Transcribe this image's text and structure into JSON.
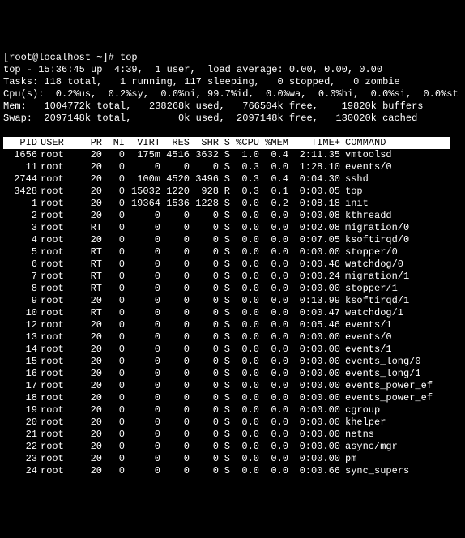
{
  "prompt": {
    "user_host": "[root@localhost ~]# ",
    "command": "top"
  },
  "summary": {
    "line1": "top - 15:36:45 up  4:39,  1 user,  load average: 0.00, 0.00, 0.00",
    "line2": "Tasks: 118 total,   1 running, 117 sleeping,   0 stopped,   0 zombie",
    "line3": "Cpu(s):  0.2%us,  0.2%sy,  0.0%ni, 99.7%id,  0.0%wa,  0.0%hi,  0.0%si,  0.0%st",
    "line4": "Mem:   1004772k total,   238268k used,   766504k free,    19820k buffers",
    "line5": "Swap:  2097148k total,        0k used,  2097148k free,   130020k cached"
  },
  "columns": [
    "PID",
    "USER",
    "PR",
    "NI",
    "VIRT",
    "RES",
    "SHR",
    "S",
    "%CPU",
    "%MEM",
    "TIME+",
    "COMMAND"
  ],
  "rows": [
    {
      "pid": "1656",
      "user": "root",
      "pr": "20",
      "ni": "0",
      "virt": "175m",
      "res": "4516",
      "shr": "3632",
      "s": "S",
      "cpu": "1.0",
      "mem": "0.4",
      "time": "2:11.35",
      "cmd": "vmtoolsd"
    },
    {
      "pid": "11",
      "user": "root",
      "pr": "20",
      "ni": "0",
      "virt": "0",
      "res": "0",
      "shr": "0",
      "s": "S",
      "cpu": "0.3",
      "mem": "0.0",
      "time": "1:28.10",
      "cmd": "events/0"
    },
    {
      "pid": "2744",
      "user": "root",
      "pr": "20",
      "ni": "0",
      "virt": "100m",
      "res": "4520",
      "shr": "3496",
      "s": "S",
      "cpu": "0.3",
      "mem": "0.4",
      "time": "0:04.30",
      "cmd": "sshd"
    },
    {
      "pid": "3428",
      "user": "root",
      "pr": "20",
      "ni": "0",
      "virt": "15032",
      "res": "1220",
      "shr": "928",
      "s": "R",
      "cpu": "0.3",
      "mem": "0.1",
      "time": "0:00.05",
      "cmd": "top"
    },
    {
      "pid": "1",
      "user": "root",
      "pr": "20",
      "ni": "0",
      "virt": "19364",
      "res": "1536",
      "shr": "1228",
      "s": "S",
      "cpu": "0.0",
      "mem": "0.2",
      "time": "0:08.18",
      "cmd": "init"
    },
    {
      "pid": "2",
      "user": "root",
      "pr": "20",
      "ni": "0",
      "virt": "0",
      "res": "0",
      "shr": "0",
      "s": "S",
      "cpu": "0.0",
      "mem": "0.0",
      "time": "0:00.08",
      "cmd": "kthreadd"
    },
    {
      "pid": "3",
      "user": "root",
      "pr": "RT",
      "ni": "0",
      "virt": "0",
      "res": "0",
      "shr": "0",
      "s": "S",
      "cpu": "0.0",
      "mem": "0.0",
      "time": "0:02.08",
      "cmd": "migration/0"
    },
    {
      "pid": "4",
      "user": "root",
      "pr": "20",
      "ni": "0",
      "virt": "0",
      "res": "0",
      "shr": "0",
      "s": "S",
      "cpu": "0.0",
      "mem": "0.0",
      "time": "0:07.05",
      "cmd": "ksoftirqd/0"
    },
    {
      "pid": "5",
      "user": "root",
      "pr": "RT",
      "ni": "0",
      "virt": "0",
      "res": "0",
      "shr": "0",
      "s": "S",
      "cpu": "0.0",
      "mem": "0.0",
      "time": "0:00.00",
      "cmd": "stopper/0"
    },
    {
      "pid": "6",
      "user": "root",
      "pr": "RT",
      "ni": "0",
      "virt": "0",
      "res": "0",
      "shr": "0",
      "s": "S",
      "cpu": "0.0",
      "mem": "0.0",
      "time": "0:00.46",
      "cmd": "watchdog/0"
    },
    {
      "pid": "7",
      "user": "root",
      "pr": "RT",
      "ni": "0",
      "virt": "0",
      "res": "0",
      "shr": "0",
      "s": "S",
      "cpu": "0.0",
      "mem": "0.0",
      "time": "0:00.24",
      "cmd": "migration/1"
    },
    {
      "pid": "8",
      "user": "root",
      "pr": "RT",
      "ni": "0",
      "virt": "0",
      "res": "0",
      "shr": "0",
      "s": "S",
      "cpu": "0.0",
      "mem": "0.0",
      "time": "0:00.00",
      "cmd": "stopper/1"
    },
    {
      "pid": "9",
      "user": "root",
      "pr": "20",
      "ni": "0",
      "virt": "0",
      "res": "0",
      "shr": "0",
      "s": "S",
      "cpu": "0.0",
      "mem": "0.0",
      "time": "0:13.99",
      "cmd": "ksoftirqd/1"
    },
    {
      "pid": "10",
      "user": "root",
      "pr": "RT",
      "ni": "0",
      "virt": "0",
      "res": "0",
      "shr": "0",
      "s": "S",
      "cpu": "0.0",
      "mem": "0.0",
      "time": "0:00.47",
      "cmd": "watchdog/1"
    },
    {
      "pid": "12",
      "user": "root",
      "pr": "20",
      "ni": "0",
      "virt": "0",
      "res": "0",
      "shr": "0",
      "s": "S",
      "cpu": "0.0",
      "mem": "0.0",
      "time": "0:05.46",
      "cmd": "events/1"
    },
    {
      "pid": "13",
      "user": "root",
      "pr": "20",
      "ni": "0",
      "virt": "0",
      "res": "0",
      "shr": "0",
      "s": "S",
      "cpu": "0.0",
      "mem": "0.0",
      "time": "0:00.00",
      "cmd": "events/0"
    },
    {
      "pid": "14",
      "user": "root",
      "pr": "20",
      "ni": "0",
      "virt": "0",
      "res": "0",
      "shr": "0",
      "s": "S",
      "cpu": "0.0",
      "mem": "0.0",
      "time": "0:00.00",
      "cmd": "events/1"
    },
    {
      "pid": "15",
      "user": "root",
      "pr": "20",
      "ni": "0",
      "virt": "0",
      "res": "0",
      "shr": "0",
      "s": "S",
      "cpu": "0.0",
      "mem": "0.0",
      "time": "0:00.00",
      "cmd": "events_long/0"
    },
    {
      "pid": "16",
      "user": "root",
      "pr": "20",
      "ni": "0",
      "virt": "0",
      "res": "0",
      "shr": "0",
      "s": "S",
      "cpu": "0.0",
      "mem": "0.0",
      "time": "0:00.00",
      "cmd": "events_long/1"
    },
    {
      "pid": "17",
      "user": "root",
      "pr": "20",
      "ni": "0",
      "virt": "0",
      "res": "0",
      "shr": "0",
      "s": "S",
      "cpu": "0.0",
      "mem": "0.0",
      "time": "0:00.00",
      "cmd": "events_power_ef"
    },
    {
      "pid": "18",
      "user": "root",
      "pr": "20",
      "ni": "0",
      "virt": "0",
      "res": "0",
      "shr": "0",
      "s": "S",
      "cpu": "0.0",
      "mem": "0.0",
      "time": "0:00.00",
      "cmd": "events_power_ef"
    },
    {
      "pid": "19",
      "user": "root",
      "pr": "20",
      "ni": "0",
      "virt": "0",
      "res": "0",
      "shr": "0",
      "s": "S",
      "cpu": "0.0",
      "mem": "0.0",
      "time": "0:00.00",
      "cmd": "cgroup"
    },
    {
      "pid": "20",
      "user": "root",
      "pr": "20",
      "ni": "0",
      "virt": "0",
      "res": "0",
      "shr": "0",
      "s": "S",
      "cpu": "0.0",
      "mem": "0.0",
      "time": "0:00.00",
      "cmd": "khelper"
    },
    {
      "pid": "21",
      "user": "root",
      "pr": "20",
      "ni": "0",
      "virt": "0",
      "res": "0",
      "shr": "0",
      "s": "S",
      "cpu": "0.0",
      "mem": "0.0",
      "time": "0:00.00",
      "cmd": "netns"
    },
    {
      "pid": "22",
      "user": "root",
      "pr": "20",
      "ni": "0",
      "virt": "0",
      "res": "0",
      "shr": "0",
      "s": "S",
      "cpu": "0.0",
      "mem": "0.0",
      "time": "0:00.00",
      "cmd": "async/mgr"
    },
    {
      "pid": "23",
      "user": "root",
      "pr": "20",
      "ni": "0",
      "virt": "0",
      "res": "0",
      "shr": "0",
      "s": "S",
      "cpu": "0.0",
      "mem": "0.0",
      "time": "0:00.00",
      "cmd": "pm"
    },
    {
      "pid": "24",
      "user": "root",
      "pr": "20",
      "ni": "0",
      "virt": "0",
      "res": "0",
      "shr": "0",
      "s": "S",
      "cpu": "0.0",
      "mem": "0.0",
      "time": "0:00.66",
      "cmd": "sync_supers"
    }
  ]
}
